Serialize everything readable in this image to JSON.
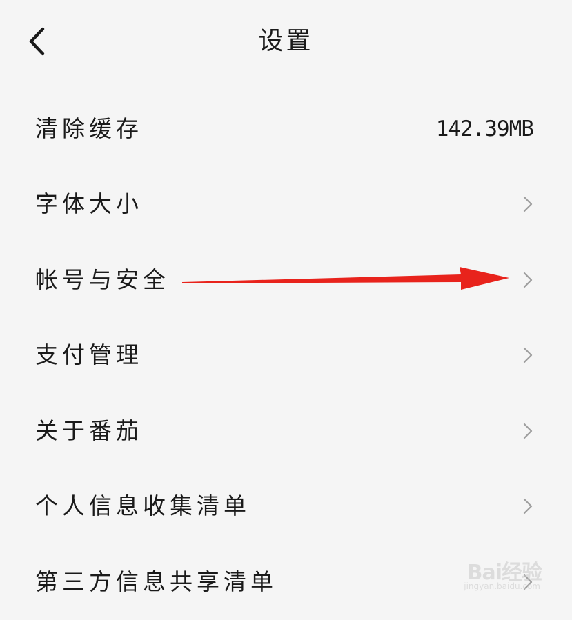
{
  "header": {
    "title": "设置",
    "back_icon": "chevron-left-icon"
  },
  "settings": {
    "items": [
      {
        "label": "清除缓存",
        "value": "142.39MB",
        "icon": ""
      },
      {
        "label": "字体大小",
        "value": "",
        "icon": "chevron-right-icon"
      },
      {
        "label": "帐号与安全",
        "value": "",
        "icon": "chevron-right-icon"
      },
      {
        "label": "支付管理",
        "value": "",
        "icon": "chevron-right-icon"
      },
      {
        "label": "关于番茄",
        "value": "",
        "icon": "chevron-right-icon"
      },
      {
        "label": "个人信息收集清单",
        "value": "",
        "icon": "chevron-right-icon"
      },
      {
        "label": "第三方信息共享清单",
        "value": "",
        "icon": "chevron-right-icon"
      }
    ]
  },
  "annotation": {
    "arrow_color": "#e8231c",
    "points_to": "帐号与安全"
  },
  "watermark": {
    "logo_text": "Bai经验",
    "url_text": "jingyan.baidu.com"
  },
  "colors": {
    "background": "#f5f5f5",
    "text": "#1a1a1a",
    "chevron": "#9e9e9e",
    "arrow": "#e8231c"
  }
}
